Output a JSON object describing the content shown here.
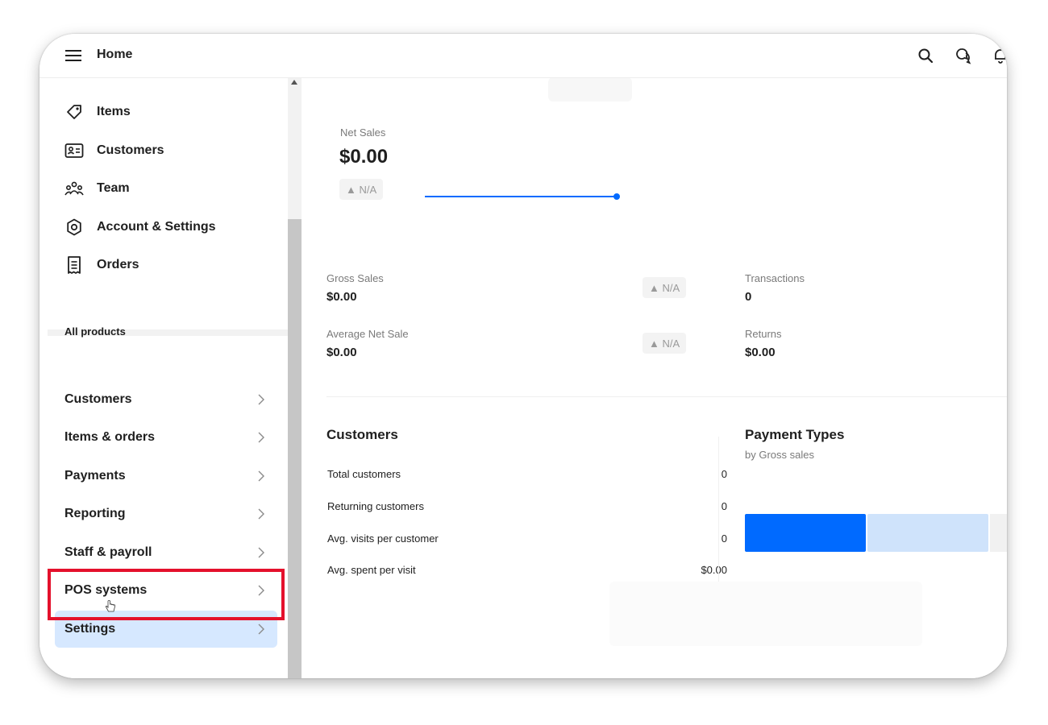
{
  "header": {
    "title": "Home"
  },
  "sidebar": {
    "items": [
      {
        "label": "Items",
        "icon": "tag-icon"
      },
      {
        "label": "Customers",
        "icon": "contact-card-icon"
      },
      {
        "label": "Team",
        "icon": "team-icon"
      },
      {
        "label": "Account & Settings",
        "icon": "gear-icon"
      },
      {
        "label": "Orders",
        "icon": "receipt-icon"
      }
    ],
    "section_title": "All products",
    "products": [
      {
        "label": "Customers"
      },
      {
        "label": "Items & orders"
      },
      {
        "label": "Payments"
      },
      {
        "label": "Reporting"
      },
      {
        "label": "Staff & payroll"
      },
      {
        "label": "POS systems"
      },
      {
        "label": "Settings",
        "active": true
      }
    ]
  },
  "summary": {
    "net_sales_label": "Net Sales",
    "net_sales_value": "$0.00",
    "net_sales_change": "▲ N/A",
    "gross_sales_label": "Gross Sales",
    "gross_sales_value": "$0.00",
    "gross_sales_change": "▲ N/A",
    "avg_net_sale_label": "Average Net Sale",
    "avg_net_sale_value": "$0.00",
    "avg_net_sale_change": "▲ N/A",
    "transactions_label": "Transactions",
    "transactions_value": "0",
    "returns_label": "Returns",
    "returns_value": "$0.00"
  },
  "customers_card": {
    "title": "Customers",
    "rows": [
      {
        "label": "Total customers",
        "value": "0"
      },
      {
        "label": "Returning customers",
        "value": "0"
      },
      {
        "label": "Avg. visits per customer",
        "value": "0"
      },
      {
        "label": "Avg. spent per visit",
        "value": "$0.00"
      }
    ]
  },
  "payment_types": {
    "title": "Payment Types",
    "subtitle": "by Gross sales"
  },
  "colors": {
    "accent": "#006aff",
    "accent_light": "#cfe3fb",
    "active_bg": "#d6e8ff",
    "highlight": "#e4112c"
  }
}
